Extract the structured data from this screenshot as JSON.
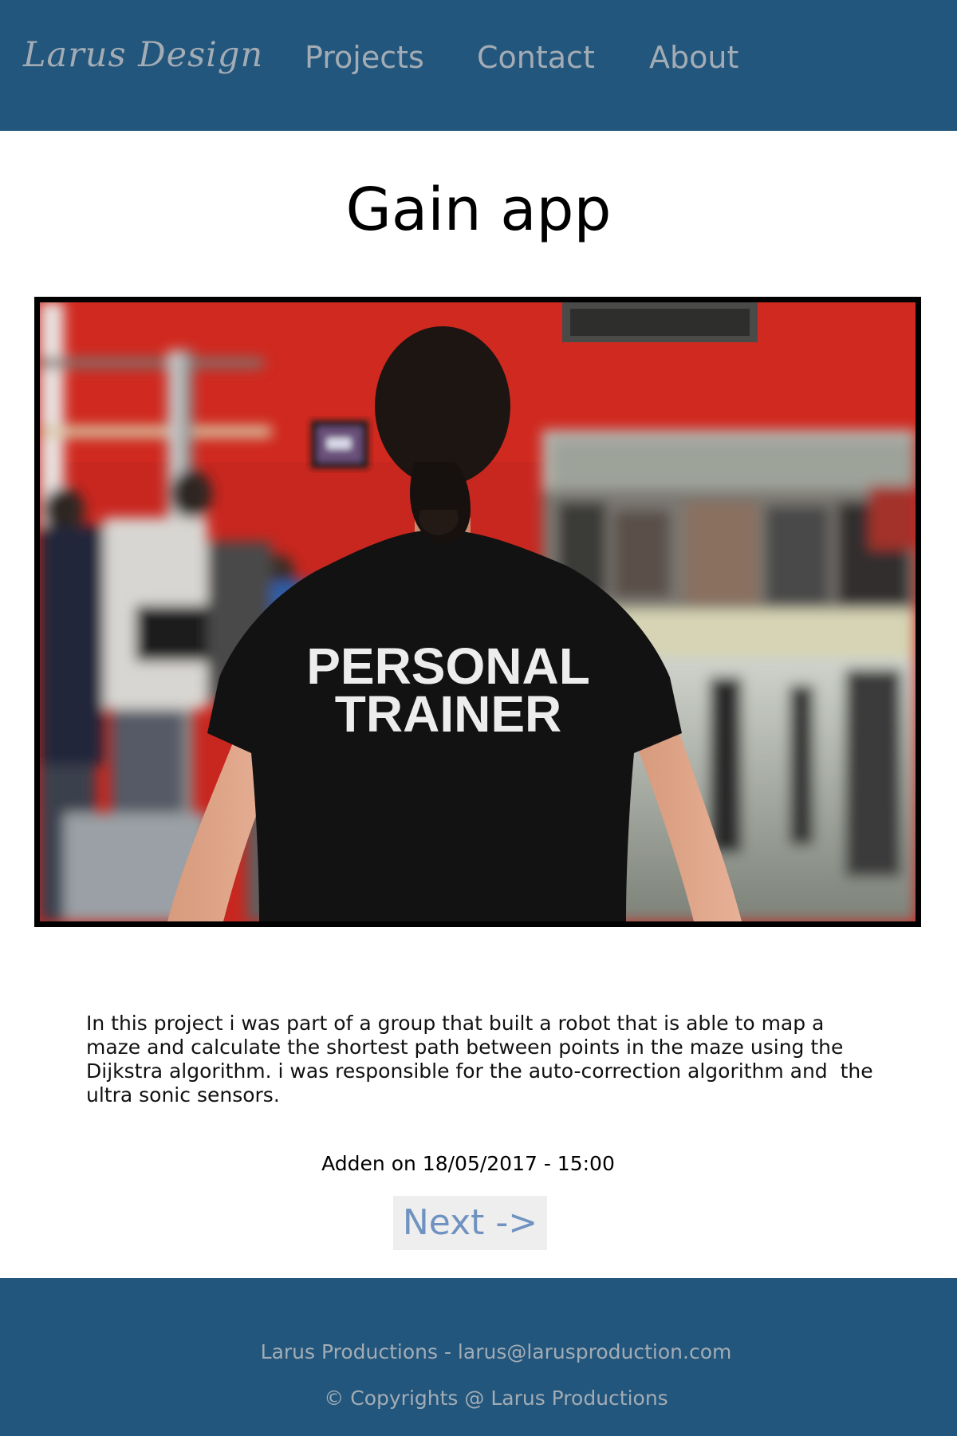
{
  "header": {
    "logo": "Larus Design",
    "nav": [
      {
        "label": "Projects"
      },
      {
        "label": "Contact"
      },
      {
        "label": "About"
      }
    ]
  },
  "main": {
    "title": "Gain app",
    "image": {
      "shirt_text_line1": "PERSONAL",
      "shirt_text_line2": "TRAINER"
    },
    "description": "In this project i was part of a group that built a robot that is able to map a maze and calculate the shortest path between points in the maze using the Dijkstra algorithm. i was responsible for the auto-correction algorithm and  the ultra sonic sensors.",
    "added": "Adden on 18/05/2017 - 15:00",
    "next_label": "Next ->"
  },
  "footer": {
    "contact": "Larus Productions - larus@larusproduction.com",
    "copyright": "© Copyrights @ Larus Productions"
  },
  "colors": {
    "header_bg": "#22567c",
    "nav_text": "#a3acb5",
    "next_text": "#6f92c0",
    "next_bg": "#eeeeee"
  }
}
